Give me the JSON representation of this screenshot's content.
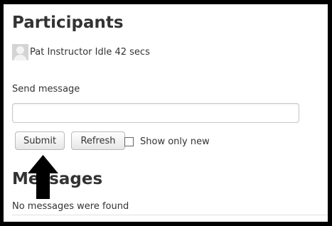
{
  "participants": {
    "title": "Participants",
    "items": [
      {
        "name": "Pat Instructor",
        "status": "Idle 42 secs",
        "display": "Pat Instructor Idle 42 secs"
      }
    ]
  },
  "send": {
    "label": "Send message",
    "value": "",
    "placeholder": "",
    "submit_label": "Submit",
    "refresh_label": "Refresh",
    "show_only_new_label": "Show only new",
    "show_only_new_checked": false
  },
  "messages": {
    "title": "Messages",
    "empty_text": "No messages were found"
  },
  "annotation": {
    "icon": "up-arrow-icon",
    "color": "#000000"
  }
}
